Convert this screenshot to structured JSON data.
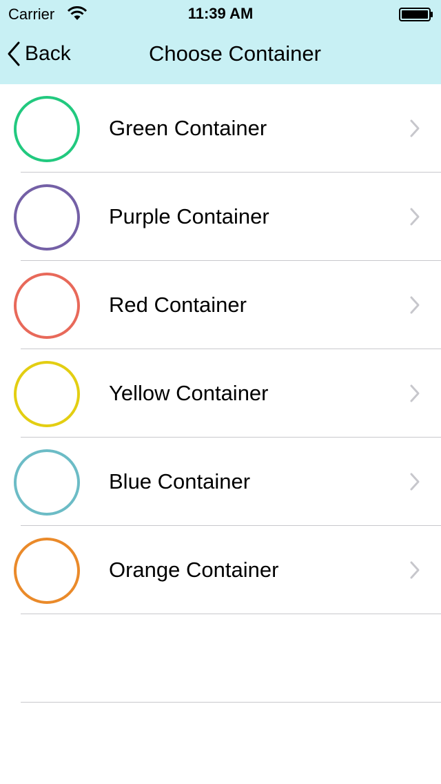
{
  "status_bar": {
    "carrier": "Carrier",
    "time": "11:39 AM",
    "wifi_icon": "wifi-icon",
    "battery_icon": "battery-icon"
  },
  "nav": {
    "back_label": "Back",
    "back_icon": "chevron-left-icon",
    "title": "Choose Container",
    "background_color": "#c8f0f4"
  },
  "containers": [
    {
      "label": "Green Container",
      "color": "#22c97f"
    },
    {
      "label": "Purple Container",
      "color": "#7460a6"
    },
    {
      "label": "Red Container",
      "color": "#e8695a"
    },
    {
      "label": "Yellow Container",
      "color": "#e3ce12"
    },
    {
      "label": "Blue Container",
      "color": "#6cbcc6"
    },
    {
      "label": "Orange Container",
      "color": "#ea8a2a"
    }
  ],
  "row_chevron_icon": "chevron-right-icon"
}
